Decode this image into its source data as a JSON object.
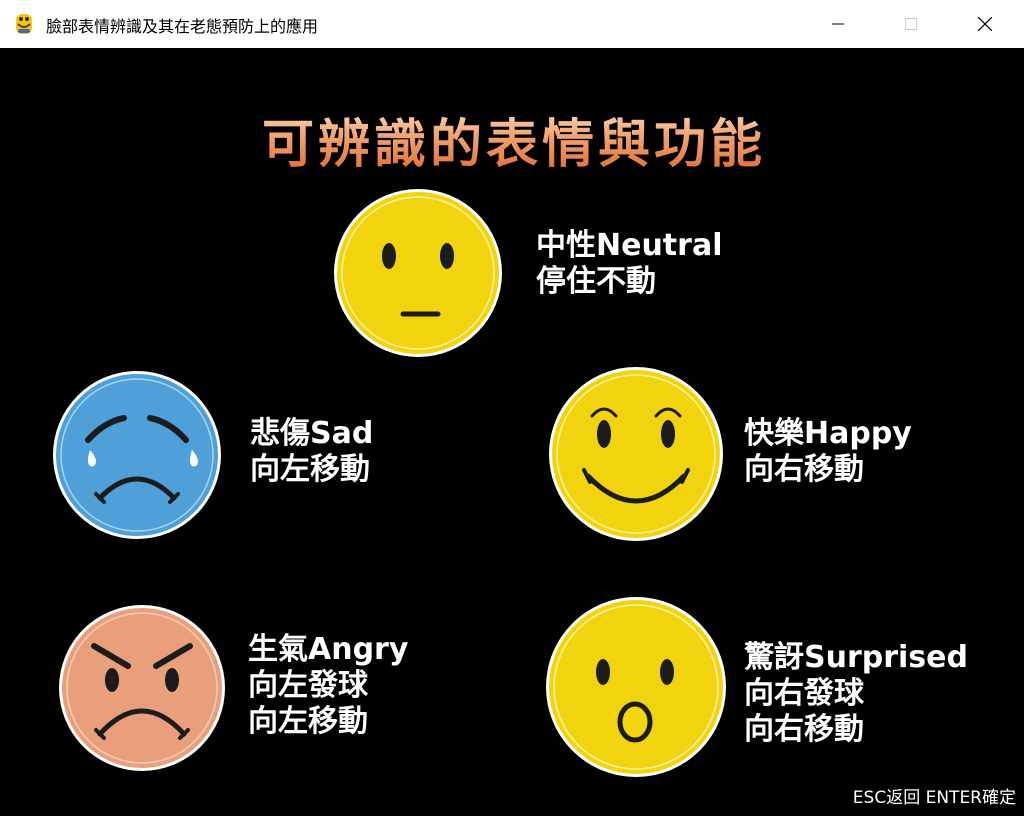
{
  "window": {
    "title": "臉部表情辨識及其在老態預防上的應用",
    "icon": "python-icon",
    "controls": [
      "minimize-icon",
      "maximize-icon",
      "close-icon"
    ]
  },
  "page": {
    "heading": "可辨識的表情與功能",
    "hint": "ESC返回 ENTER確定"
  },
  "expressions": {
    "neutral": {
      "line1": "中性Neutral",
      "line2": "停住不動",
      "color": "#f2d40e",
      "icon": "neutral-face-icon"
    },
    "sad": {
      "line1": "悲傷Sad",
      "line2": "向左移動",
      "color": "#4f9fd8",
      "icon": "sad-face-icon"
    },
    "happy": {
      "line1": "快樂Happy",
      "line2": "向右移動",
      "color": "#f2d40e",
      "icon": "happy-face-icon"
    },
    "angry": {
      "line1": "生氣Angry",
      "line2": "向左發球",
      "line3": "向左移動",
      "color": "#e9a07a",
      "icon": "angry-face-icon"
    },
    "surprised": {
      "line1": "驚訝Surprised",
      "line2": "向右發球",
      "line3": "向右移動",
      "color": "#f2d40e",
      "icon": "surprised-face-icon"
    }
  }
}
